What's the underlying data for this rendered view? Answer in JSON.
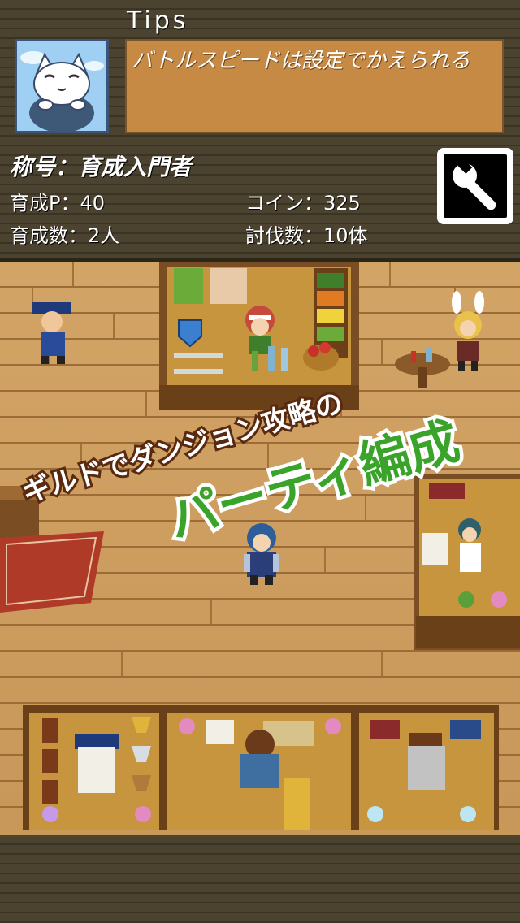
{
  "tips": {
    "title": "Tips",
    "message": "バトルスピードは設定でかえられる"
  },
  "player": {
    "title_line": "称号：育成入門者",
    "stats": {
      "training_points": "育成P：40",
      "coins": "コイン：325",
      "trained_count": "育成数：2人",
      "defeated_count": "討伐数：10体"
    }
  },
  "promo": {
    "line1": "ギルドでダンジョン攻略の",
    "line2": "パーティ編成"
  },
  "icons": {
    "settings": "wrench-icon",
    "avatar": "cat-avatar-icon"
  },
  "colors": {
    "header_bg": "#4b4330",
    "tips_box": "#c68a45",
    "floor": "#c8975a",
    "promo_green": "#3aa42a",
    "promo_white": "#ffffff"
  }
}
